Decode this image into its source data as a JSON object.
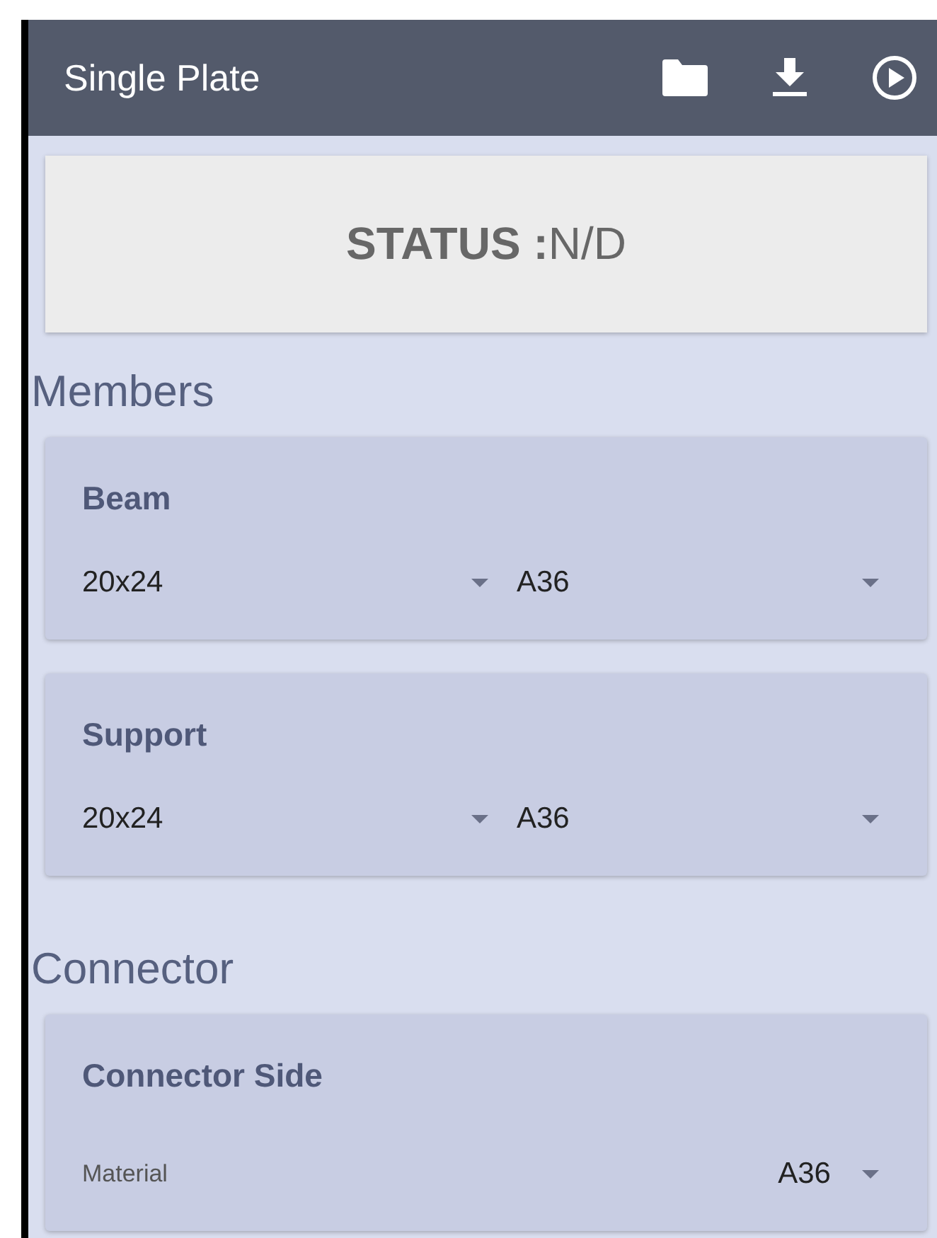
{
  "app_bar": {
    "title": "Single Plate"
  },
  "status": {
    "label": "STATUS :",
    "value": "N/D"
  },
  "sections": [
    {
      "title": "Members",
      "cards": [
        {
          "title": "Beam",
          "kind": "pair",
          "fields": [
            {
              "value": "20x24"
            },
            {
              "value": "A36"
            }
          ]
        },
        {
          "title": "Support",
          "kind": "pair",
          "fields": [
            {
              "value": "20x24"
            },
            {
              "value": "A36"
            }
          ]
        }
      ]
    },
    {
      "title": "Connector",
      "cards": [
        {
          "title": "Connector Side",
          "kind": "labeled",
          "fields": [
            {
              "label": "Material",
              "value": "A36"
            }
          ]
        }
      ]
    }
  ]
}
